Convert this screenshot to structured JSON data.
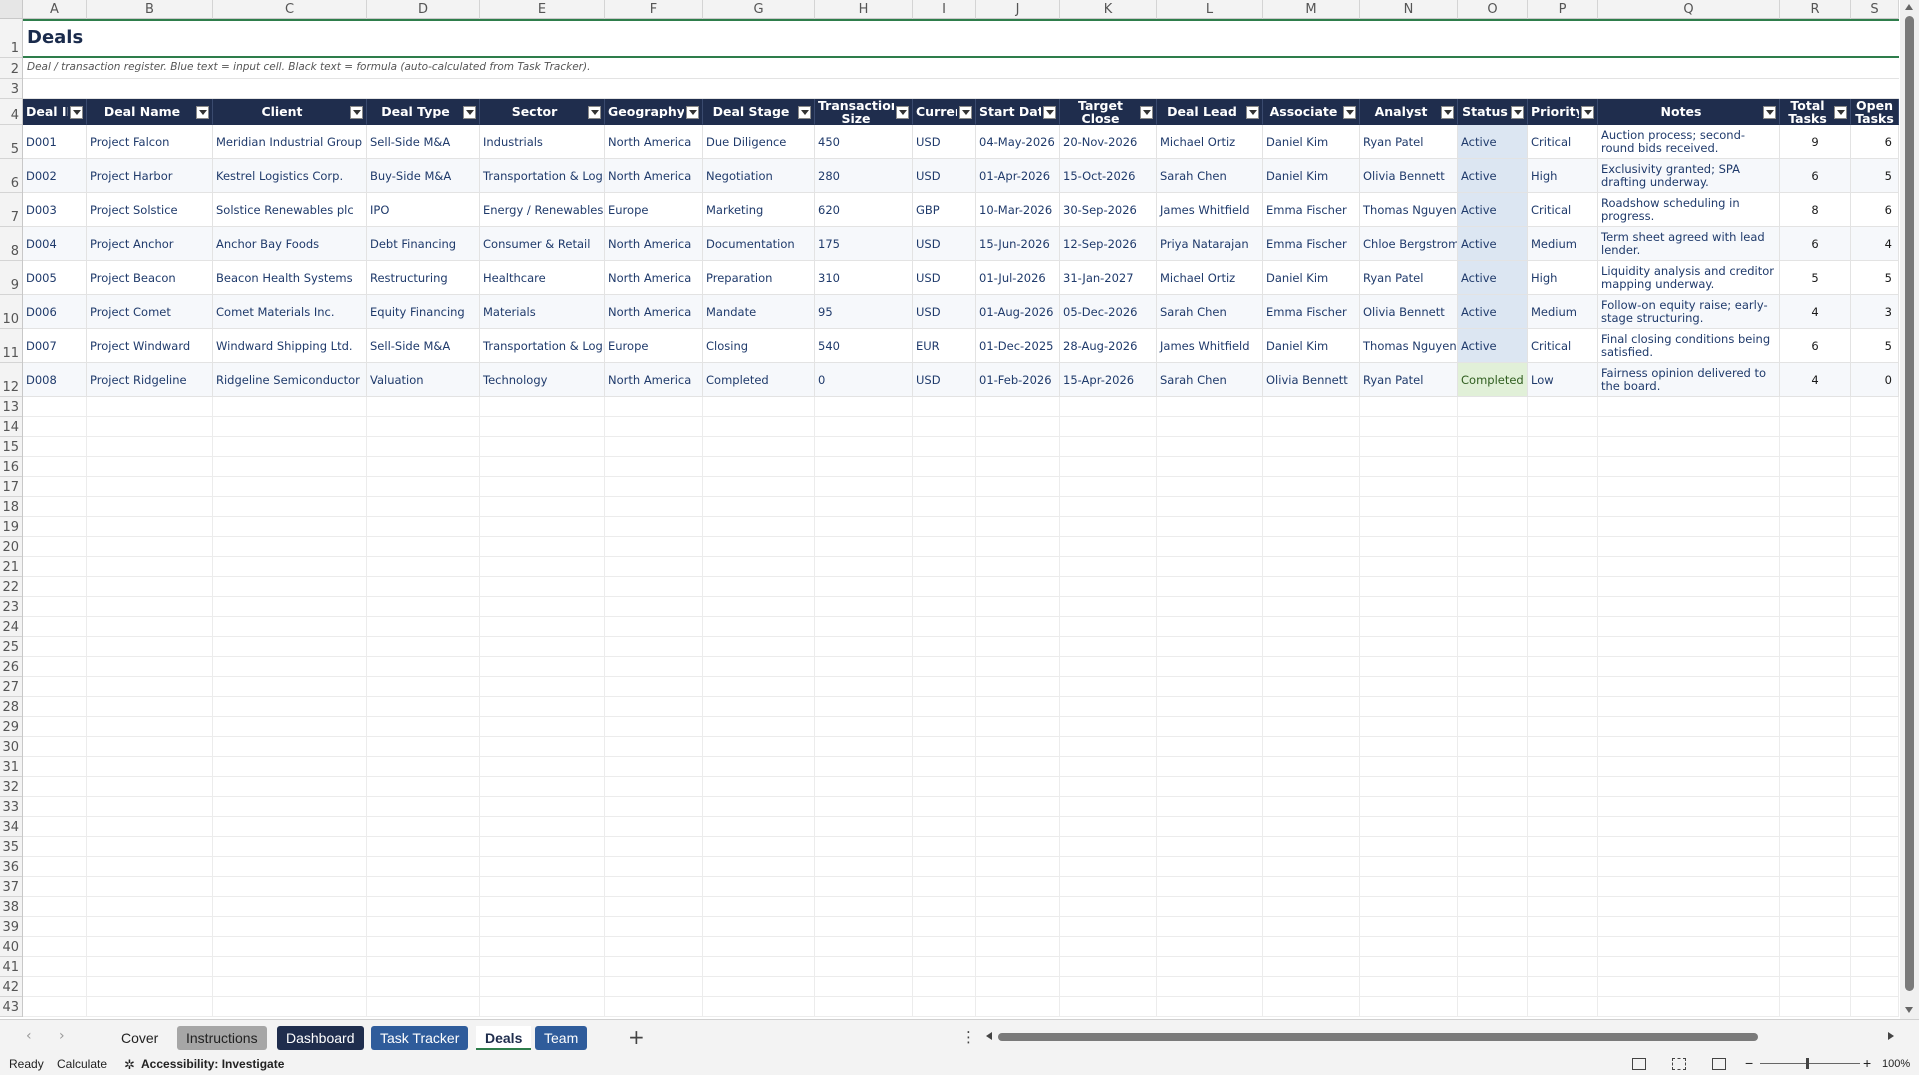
{
  "sheet": {
    "title": "Deals",
    "subtitle": "Deal / transaction register. Blue text = input cell. Black text = formula (auto-calculated from Task Tracker)."
  },
  "columns": [
    "A",
    "B",
    "C",
    "D",
    "E",
    "F",
    "G",
    "H",
    "I",
    "J",
    "K",
    "L",
    "M",
    "N",
    "O",
    "P",
    "Q",
    "R",
    "S"
  ],
  "rows": [
    "1",
    "2",
    "3",
    "4",
    "5",
    "6",
    "7",
    "8",
    "9",
    "10",
    "11",
    "12",
    "13",
    "14",
    "15",
    "16",
    "17",
    "18",
    "19",
    "20",
    "21",
    "22",
    "23",
    "24",
    "25",
    "26",
    "27",
    "28",
    "29",
    "30",
    "31",
    "32",
    "33",
    "34",
    "35",
    "36",
    "37",
    "38",
    "39",
    "40",
    "41",
    "42",
    "43"
  ],
  "headers": [
    "Deal ID",
    "Deal Name",
    "Client",
    "Deal Type",
    "Sector",
    "Geography",
    "Deal Stage",
    "Transaction Size ($mm)",
    "Currency",
    "Start Date",
    "Target Close Date",
    "Deal Lead",
    "Associate",
    "Analyst",
    "Status",
    "Priority",
    "Notes",
    "Total Tasks",
    "Open Tasks"
  ],
  "deals": [
    [
      "D001",
      "Project Falcon",
      "Meridian Industrial Group",
      "Sell-Side M&A",
      "Industrials",
      "North America",
      "Due Diligence",
      "450",
      "USD",
      "04-May-2026",
      "20-Nov-2026",
      "Michael Ortiz",
      "Daniel Kim",
      "Ryan Patel",
      "Active",
      "Critical",
      "Auction process; second-round bids received.",
      "9",
      "6"
    ],
    [
      "D002",
      "Project Harbor",
      "Kestrel Logistics Corp.",
      "Buy-Side M&A",
      "Transportation & Logistics",
      "North America",
      "Negotiation",
      "280",
      "USD",
      "01-Apr-2026",
      "15-Oct-2026",
      "Sarah Chen",
      "Daniel Kim",
      "Olivia Bennett",
      "Active",
      "High",
      "Exclusivity granted; SPA drafting underway.",
      "6",
      "5"
    ],
    [
      "D003",
      "Project Solstice",
      "Solstice Renewables plc",
      "IPO",
      "Energy / Renewables",
      "Europe",
      "Marketing",
      "620",
      "GBP",
      "10-Mar-2026",
      "30-Sep-2026",
      "James Whitfield",
      "Emma Fischer",
      "Thomas Nguyen",
      "Active",
      "Critical",
      "Roadshow scheduling in progress.",
      "8",
      "6"
    ],
    [
      "D004",
      "Project Anchor",
      "Anchor Bay Foods",
      "Debt Financing",
      "Consumer & Retail",
      "North America",
      "Documentation",
      "175",
      "USD",
      "15-Jun-2026",
      "12-Sep-2026",
      "Priya Natarajan",
      "Emma Fischer",
      "Chloe Bergstrom",
      "Active",
      "Medium",
      "Term sheet agreed with lead lender.",
      "6",
      "4"
    ],
    [
      "D005",
      "Project Beacon",
      "Beacon Health Systems",
      "Restructuring",
      "Healthcare",
      "North America",
      "Preparation",
      "310",
      "USD",
      "01-Jul-2026",
      "31-Jan-2027",
      "Michael Ortiz",
      "Daniel Kim",
      "Ryan Patel",
      "Active",
      "High",
      "Liquidity analysis and creditor mapping underway.",
      "5",
      "5"
    ],
    [
      "D006",
      "Project Comet",
      "Comet Materials Inc.",
      "Equity Financing",
      "Materials",
      "North America",
      "Mandate",
      "95",
      "USD",
      "01-Aug-2026",
      "05-Dec-2026",
      "Sarah Chen",
      "Emma Fischer",
      "Olivia Bennett",
      "Active",
      "Medium",
      "Follow-on equity raise; early-stage structuring.",
      "4",
      "3"
    ],
    [
      "D007",
      "Project Windward",
      "Windward Shipping Ltd.",
      "Sell-Side M&A",
      "Transportation & Logistics",
      "Europe",
      "Closing",
      "540",
      "EUR",
      "01-Dec-2025",
      "28-Aug-2026",
      "James Whitfield",
      "Daniel Kim",
      "Thomas Nguyen",
      "Active",
      "Critical",
      "Final closing conditions being satisfied.",
      "6",
      "5"
    ],
    [
      "D008",
      "Project Ridgeline",
      "Ridgeline Semiconductor",
      "Valuation",
      "Technology",
      "North America",
      "Completed",
      "0",
      "USD",
      "01-Feb-2026",
      "15-Apr-2026",
      "Sarah Chen",
      "Olivia Bennett",
      "Ryan Patel",
      "Completed",
      "Low",
      "Fairness opinion delivered to the board.",
      "4",
      "0"
    ]
  ],
  "tabs": [
    {
      "label": "Cover",
      "style": "plain"
    },
    {
      "label": "Instructions",
      "style": "gray"
    },
    {
      "label": "Dashboard",
      "style": "navy"
    },
    {
      "label": "Task Tracker",
      "style": "blue"
    },
    {
      "label": "Deals",
      "style": "active"
    },
    {
      "label": "Team",
      "style": "blue"
    }
  ],
  "statusbar": {
    "ready": "Ready",
    "calculate": "Calculate",
    "accessibility": "Accessibility: Investigate",
    "zoom": "100%"
  },
  "icons": {
    "add_sheet": "+",
    "more": "⋮",
    "prev": "‹",
    "next": "›"
  },
  "colors": {
    "header_bg": "#1f2d4d",
    "title_rule": "#2e7d4b",
    "status_active_bg": "#dce6f2",
    "status_completed_bg": "#e1f0d8"
  }
}
